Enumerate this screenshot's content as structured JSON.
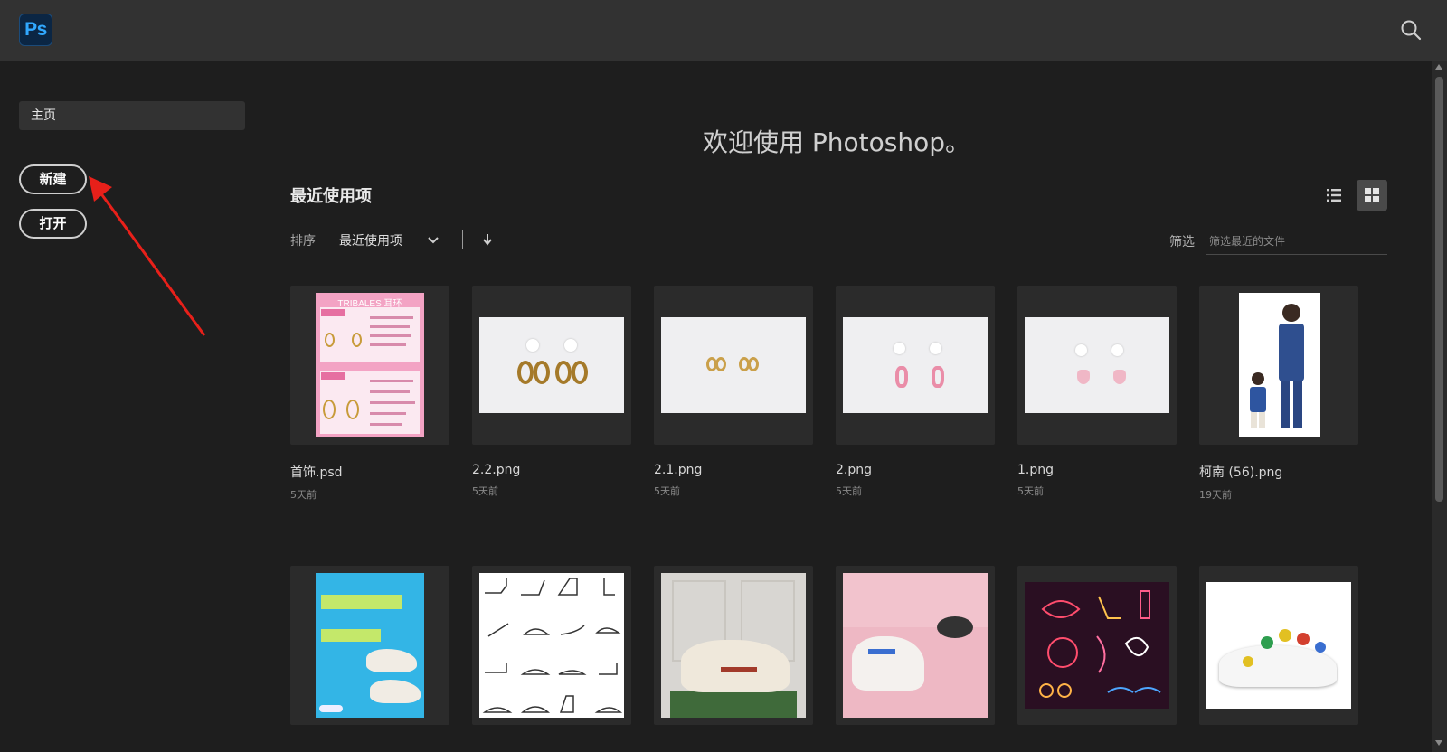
{
  "app": {
    "logo_text": "Ps",
    "accent": "#31a8ff"
  },
  "topbar": {
    "search_icon": "search-icon"
  },
  "sidebar": {
    "home_label": "主页",
    "new_label": "新建",
    "open_label": "打开"
  },
  "main": {
    "welcome": "欢迎使用 Photoshop。",
    "recent_title": "最近使用项",
    "sort": {
      "label": "排序",
      "value": "最近使用项"
    },
    "filter": {
      "label": "筛选",
      "placeholder": "筛选最近的文件"
    },
    "view_modes": [
      "list-view-icon",
      "grid-view-icon"
    ],
    "active_view": "grid"
  },
  "files": [
    {
      "name": "首饰.psd",
      "date": "5天前",
      "thumb": "pink-poster"
    },
    {
      "name": "2.2.png",
      "date": "5天前",
      "thumb": "earrings"
    },
    {
      "name": "2.1.png",
      "date": "5天前",
      "thumb": "earrings-small"
    },
    {
      "name": "2.png",
      "date": "5天前",
      "thumb": "earrings-pink"
    },
    {
      "name": "1.png",
      "date": "5天前",
      "thumb": "earrings-light"
    },
    {
      "name": "柯南 (56).png",
      "date": "19天前",
      "thumb": "cartoon"
    },
    {
      "name": "",
      "date": "",
      "thumb": "sneaker-poster"
    },
    {
      "name": "",
      "date": "",
      "thumb": "shoe-icons"
    },
    {
      "name": "",
      "date": "",
      "thumb": "sneaker-photo"
    },
    {
      "name": "",
      "date": "",
      "thumb": "pink-hoodie"
    },
    {
      "name": "",
      "date": "",
      "thumb": "neon-icons"
    },
    {
      "name": "",
      "date": "",
      "thumb": "sneaker-color"
    }
  ]
}
